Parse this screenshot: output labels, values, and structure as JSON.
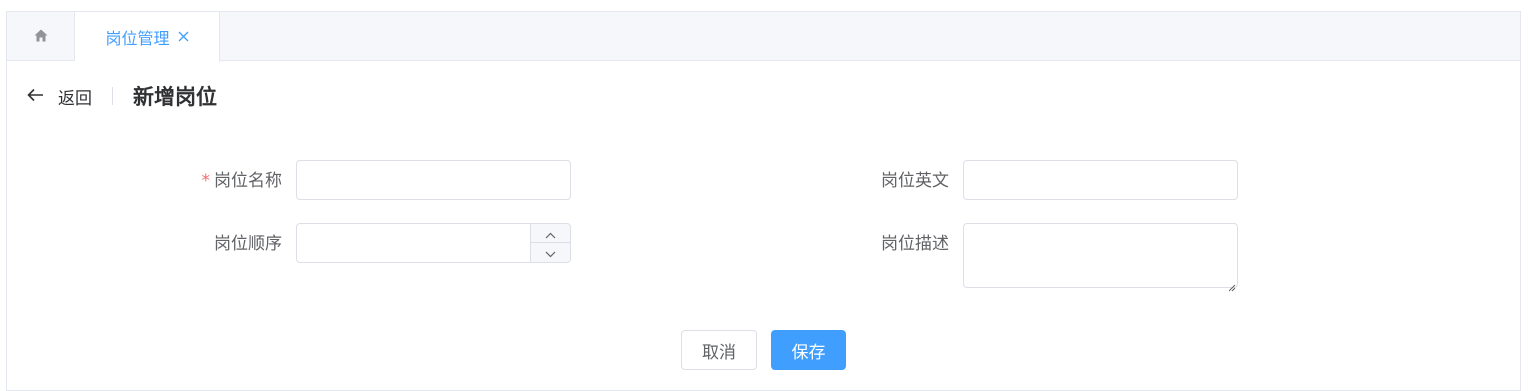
{
  "tabs": {
    "home_icon": "home-icon",
    "active_tab_label": "岗位管理",
    "close_icon": "close-icon"
  },
  "header": {
    "back_label": "返回",
    "title": "新增岗位"
  },
  "form": {
    "name_label": "岗位名称",
    "name_required_mark": "*",
    "name_value": "",
    "english_label": "岗位英文",
    "english_value": "",
    "order_label": "岗位顺序",
    "order_value": "",
    "desc_label": "岗位描述",
    "desc_value": ""
  },
  "actions": {
    "cancel_label": "取消",
    "save_label": "保存"
  },
  "colors": {
    "primary": "#409eff",
    "required": "#f56c6c",
    "border": "#dcdfe6"
  }
}
